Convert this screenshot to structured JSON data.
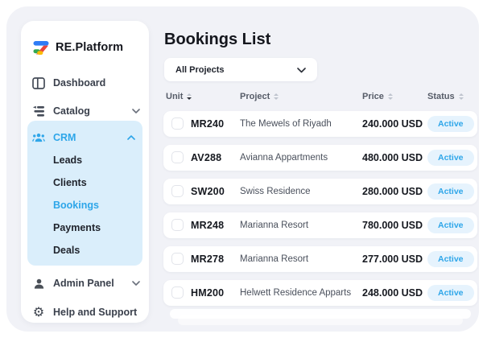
{
  "app": {
    "name": "RE.Platform"
  },
  "sidebar": {
    "logo_text": "RE.Platform",
    "dashboard_label": "Dashboard",
    "catalog_label": "Catalog",
    "crm_label": "CRM",
    "crm_children": [
      "Leads",
      "Clients",
      "Bookings",
      "Payments",
      "Deals"
    ],
    "active_item": "Bookings",
    "admin_label": "Admin Panel",
    "help_label": "Help and Support"
  },
  "main": {
    "title": "Bookings List",
    "project_filter": {
      "value": "All Projects"
    },
    "table": {
      "columns": [
        {
          "label": "Unit",
          "sort": "desc"
        },
        {
          "label": "Project",
          "sort": "none"
        },
        {
          "label": "Price",
          "sort": "none"
        },
        {
          "label": "Status",
          "sort": "none"
        }
      ],
      "rows": [
        {
          "unit": "MR240",
          "project": "The Mewels of Riyadh",
          "price": "240.000 USD",
          "status": "Active"
        },
        {
          "unit": "AV288",
          "project": "Avianna Appartments",
          "price": "480.000 USD",
          "status": "Active"
        },
        {
          "unit": "SW200",
          "project": "Swiss Residence",
          "price": "280.000 USD",
          "status": "Active"
        },
        {
          "unit": "MR248",
          "project": "Marianna Resort",
          "price": "780.000 USD",
          "status": "Active"
        },
        {
          "unit": "MR278",
          "project": "Marianna Resort",
          "price": "277.000 USD",
          "status": "Active"
        },
        {
          "unit": "HM200",
          "project": "Helwett Residence Apparts",
          "price": "248.000 USD",
          "status": "Active"
        }
      ]
    }
  },
  "colors": {
    "accent_blue": "#2EA6E9",
    "badge_bg": "#E6F3FD",
    "crm_highlight_bg": "#DAEEFB",
    "app_bg": "#F1F2F7",
    "card_bg": "#FFFFFF",
    "text_dark": "#14161D",
    "logo_blue": "#2E7CF6",
    "logo_red": "#E8453C",
    "logo_green": "#34A853",
    "logo_yellow": "#FBBC05"
  }
}
